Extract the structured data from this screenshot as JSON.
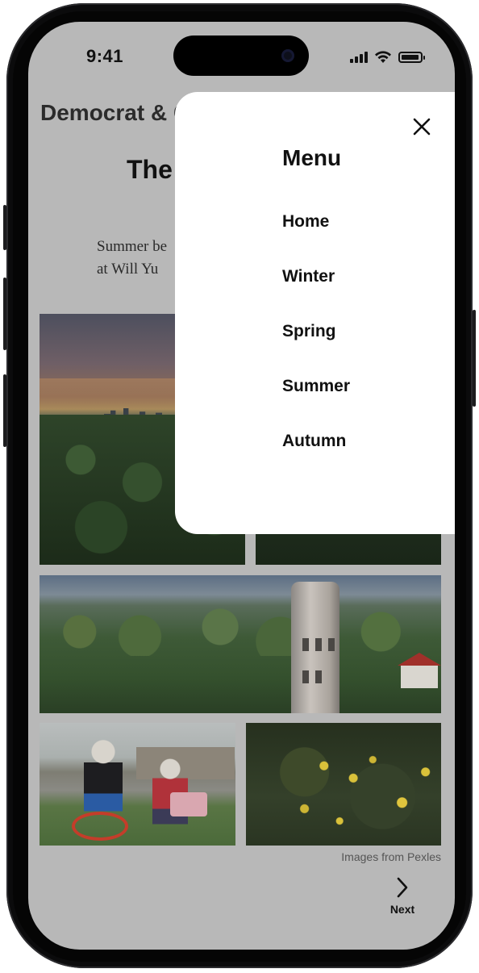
{
  "status_bar": {
    "time": "9:41"
  },
  "page": {
    "brand": "Democrat & C",
    "title": "The",
    "caption": "Summer be\nat Will Yu",
    "images_credit": "Images from Pexles",
    "photos": [
      {
        "name": "sunset-city-skyline-photo"
      },
      {
        "name": "forest-photo"
      },
      {
        "name": "water-tower-aerial-photo"
      },
      {
        "name": "kids-on-bikes-photo"
      },
      {
        "name": "yellow-wildflowers-photo"
      }
    ],
    "next": {
      "label": "Next",
      "icon": "chevron-right-icon"
    }
  },
  "menu": {
    "title": "Menu",
    "close_icon": "close-icon",
    "items": [
      {
        "label": "Home"
      },
      {
        "label": "Winter"
      },
      {
        "label": "Spring"
      },
      {
        "label": "Summer"
      },
      {
        "label": "Autumn"
      }
    ]
  },
  "colors": {
    "overlay_background": "#b8b8b8",
    "menu_background": "#ffffff",
    "text_primary": "#111111",
    "phone_frame": "#0b0b0c"
  }
}
